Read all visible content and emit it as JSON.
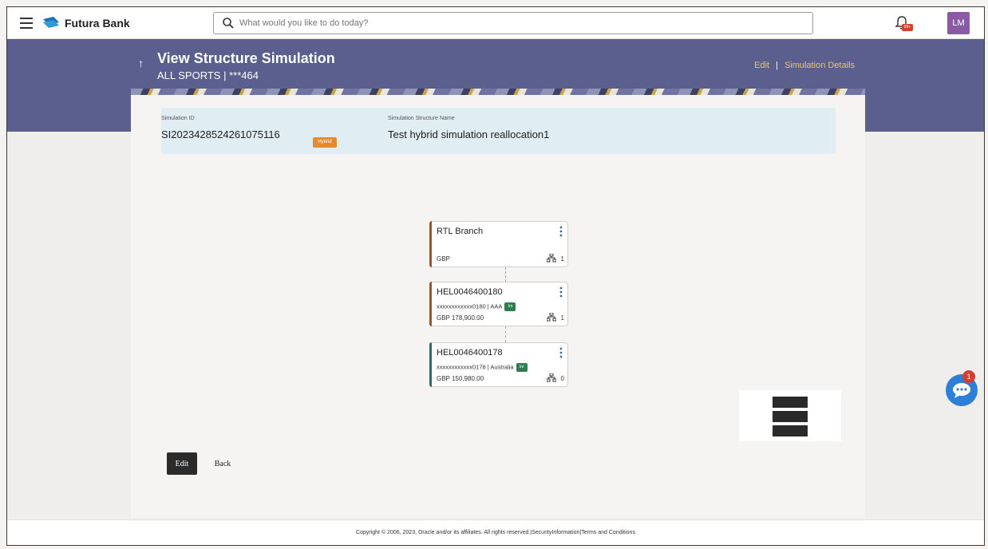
{
  "header": {
    "brand": "Futura Bank",
    "search_placeholder": "What would you like to do today?",
    "notification_badge": "99+",
    "avatar_initials": "LM"
  },
  "banner": {
    "title": "View Structure Simulation",
    "subtitle": "ALL SPORTS | ***464",
    "links": {
      "edit": "Edit",
      "separator": "|",
      "simulation_details": "Simulation Details"
    }
  },
  "simulation": {
    "id_label": "Simulation ID",
    "id_value": "SI2023428524261075116",
    "type_badge": "Hybrid",
    "name_label": "Simulation Structure Name",
    "name_value": "Test hybrid simulation reallocation1"
  },
  "tree": [
    {
      "name": "RTL Branch",
      "meta": "",
      "badge": "",
      "amount": "GBP",
      "children_count": "1",
      "bar_color": "#a0522d"
    },
    {
      "name": "HEL0046400180",
      "meta": "xxxxxxxxxxxx0180 | AAA",
      "badge": "Int",
      "amount": "GBP 178,900.00",
      "children_count": "1",
      "bar_color": "#a0522d"
    },
    {
      "name": "HEL0046400178",
      "meta": "xxxxxxxxxxxx0178 | Australia",
      "badge": "Int",
      "amount": "GBP 150,980.00",
      "children_count": "0",
      "bar_color": "#2e6b6b"
    }
  ],
  "actions": {
    "edit": "Edit",
    "back": "Back"
  },
  "footer": {
    "copyright": "Copyright © 2006, 2023, Oracle and/or its affiliates. All rights reserved.|SecurityInformation|Terms and Conditions"
  },
  "chat": {
    "badge": "1"
  },
  "colors": {
    "banner": "#5b5f8e",
    "accent_link": "#e7c66a",
    "hybrid": "#e58b2c",
    "int": "#2d7d4f"
  }
}
